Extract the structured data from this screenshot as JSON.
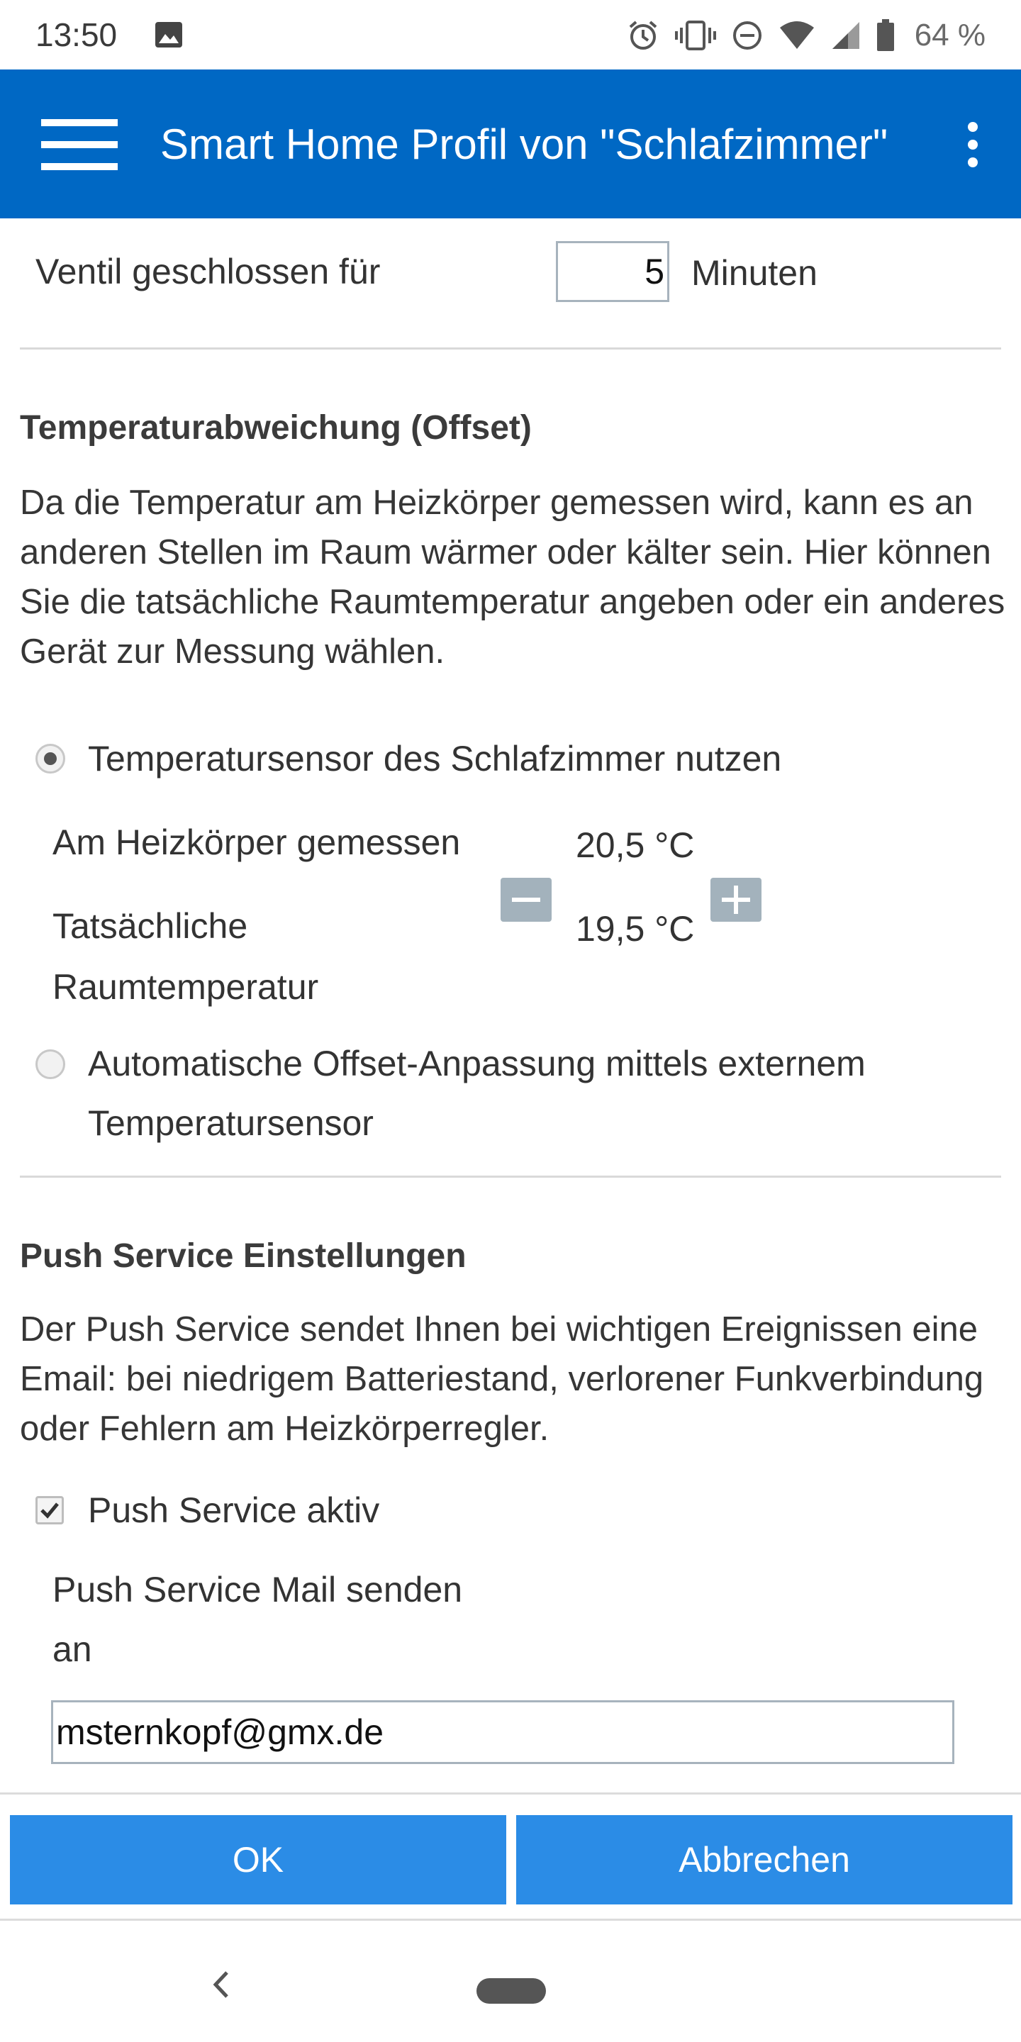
{
  "status_bar": {
    "time": "13:50",
    "battery_text": "64 %",
    "icons": [
      "image-icon",
      "alarm-icon",
      "vibrate-icon",
      "do-not-disturb-icon",
      "wifi-icon",
      "signal-icon",
      "battery-icon"
    ]
  },
  "app_bar": {
    "title": "Smart Home Profil von \"Schlafzimmer\"",
    "background": "#0068c4"
  },
  "valve": {
    "label": "Ventil geschlossen für",
    "value": "5",
    "unit": "Minuten"
  },
  "offset": {
    "title": "Temperaturabweichung (Offset)",
    "description": "Da die Temperatur am Heizkörper gemessen wird, kann es an anderen Stellen im Raum wärmer oder kälter sein. Hier können Sie die tatsächliche Raumtemperatur angeben oder ein anderes Gerät zur Messung wählen.",
    "option_sensor_label": "Temperatursensor des Schlafzimmer nutzen",
    "measured_label": "Am Heizkörper gemessen",
    "measured_value": "20,5 °C",
    "actual_label_line1": "Tatsächliche",
    "actual_label_line2": "Raumtemperatur",
    "actual_value": "19,5 °C",
    "option_auto_label_line1": "Automatische Offset-Anpassung mittels externem",
    "option_auto_label_line2": "Temperatursensor"
  },
  "push": {
    "title": "Push Service Einstellungen",
    "description": "Der Push Service sendet Ihnen bei wichtigen Ereignissen eine Email: bei niedrigem Batteriestand, verlorener Funkverbindung oder Fehlern am Heizkörperregler.",
    "active_label": "Push Service aktiv",
    "mail_label_line1": "Push Service Mail senden",
    "mail_label_line2": "an",
    "email": "msternkopf@gmx.de"
  },
  "buttons": {
    "ok": "OK",
    "cancel": "Abbrechen",
    "color": "#2b8ce6"
  }
}
